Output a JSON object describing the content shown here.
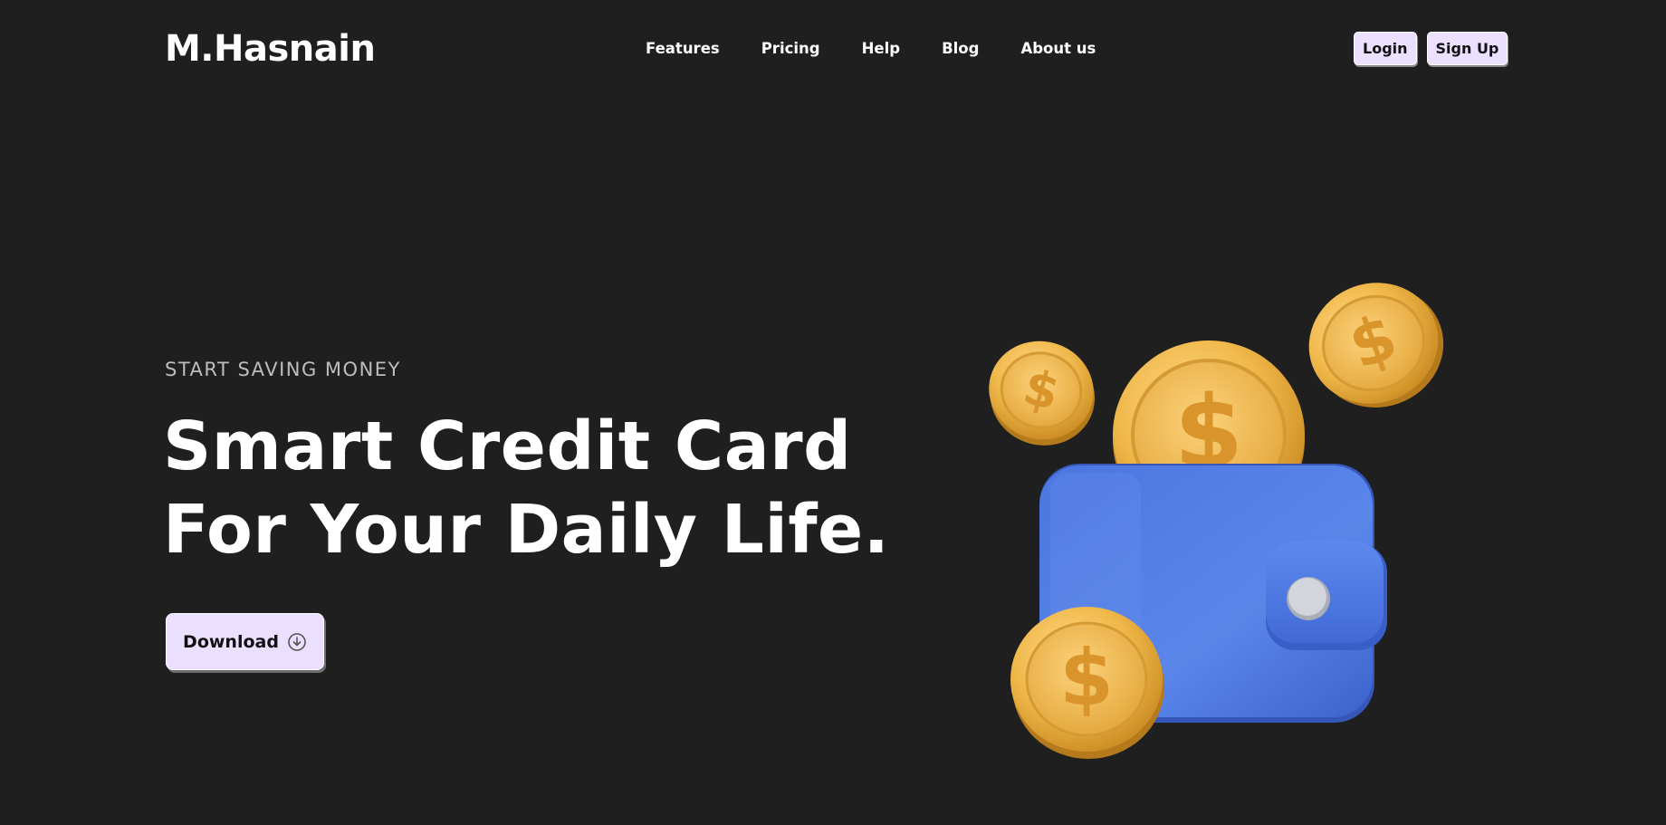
{
  "header": {
    "logo": "M.Hasnain",
    "nav": [
      {
        "label": "Features"
      },
      {
        "label": "Pricing"
      },
      {
        "label": "Help"
      },
      {
        "label": "Blog"
      },
      {
        "label": "About us"
      }
    ],
    "login_label": "Login",
    "signup_label": "Sign Up"
  },
  "hero": {
    "eyebrow": "START SAVING MONEY",
    "headline_line1": "Smart Credit Card",
    "headline_line2": "For Your Daily Life.",
    "download_label": "Download",
    "download_icon": "download-circle-icon"
  },
  "illustration": {
    "name": "wallet-with-coins",
    "wallet_color": "#4f7be0",
    "coin_color": "#f0b84a",
    "coin_symbol": "$"
  },
  "colors": {
    "background": "#1f1f20",
    "button_bg": "#ebe0ff",
    "text": "#ffffff",
    "muted_text": "#bdbdbd"
  }
}
